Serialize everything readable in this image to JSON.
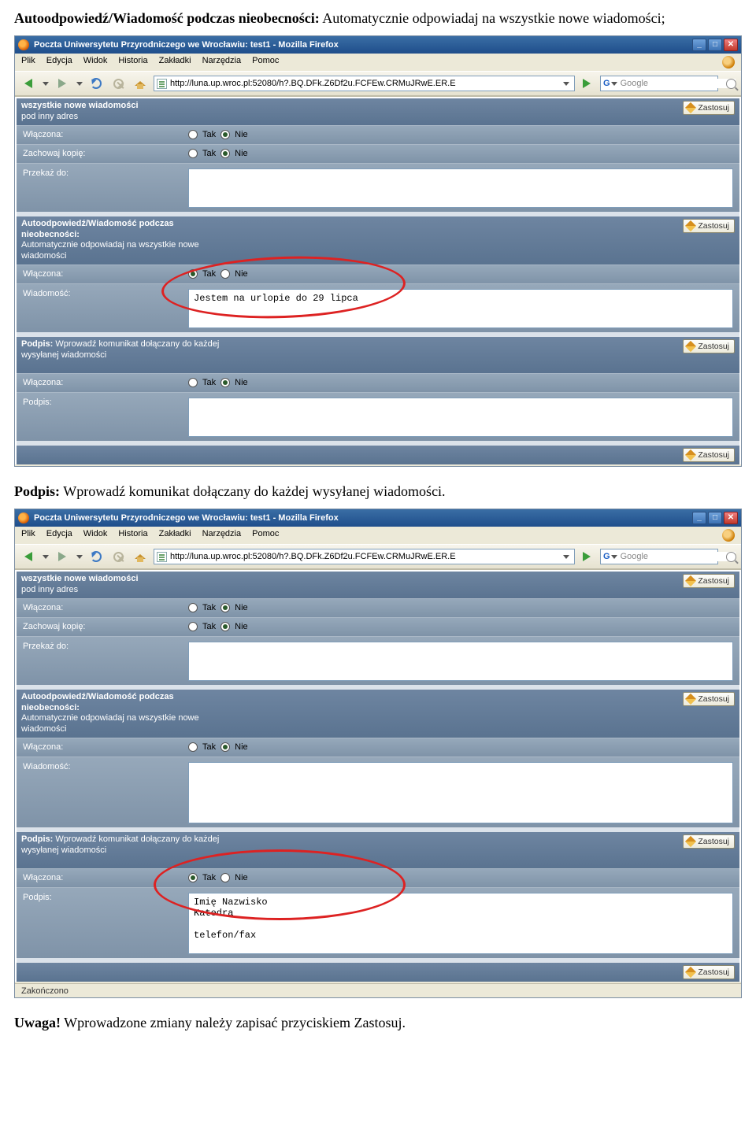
{
  "heading1_bold": "Autoodpowiedź/Wiadomość podczas nieobecności:",
  "heading1_rest": " Automatycznie odpowiadaj na wszystkie nowe wiadomości;",
  "heading2_bold": "Podpis:",
  "heading2_rest": " Wprowadź komunikat dołączany do każdej wysyłanej wiadomości.",
  "note_bold": "Uwaga!",
  "note_rest": " Wprowadzone zmiany należy zapisać przyciskiem Zastosuj.",
  "browser": {
    "title": "Poczta Uniwersytetu Przyrodniczego we Wrocławiu: test1 - Mozilla Firefox",
    "menu": {
      "plik": "Plik",
      "edycja": "Edycja",
      "widok": "Widok",
      "historia": "Historia",
      "zakladki": "Zakładki",
      "narzedzia": "Narzędzia",
      "pomoc": "Pomoc"
    },
    "url": "http://luna.up.wroc.pl:52080/h?.BQ.DFk.Z6Df2u.FCFEw.CRMuJRwE.ER.E",
    "search_placeholder": "Google",
    "min": "_",
    "max": "□",
    "close": "✕",
    "status_done": "Zakończono"
  },
  "ui": {
    "zastosuj": "Zastosuj",
    "tak": "Tak",
    "nie": "Nie",
    "forward_all": "wszystkie nowe wiadomości",
    "forward_sub": "pod inny adres",
    "wlaczona": "Włączona:",
    "zachowaj_kopie": "Zachowaj kopię:",
    "przekaz_do": "Przekaż do:",
    "auto_heading": "Autoodpowiedź/Wiadomość podczas nieobecności:",
    "auto_sub": "Automatycznie odpowiadaj na wszystkie nowe wiadomości",
    "wiadomosc": "Wiadomość:",
    "podpis_heading": "Podpis:",
    "podpis_sub": "Wprowadź komunikat dołączany do każdej wysyłanej wiadomości",
    "podpis_label": "Podpis:"
  },
  "shot1": {
    "message_text": "Jestem na urlopie do 29 lipca",
    "auto_on": "tak",
    "podpis_on": "nie",
    "podpis_text": ""
  },
  "shot2": {
    "message_text": "",
    "auto_on": "nie",
    "podpis_on": "tak",
    "podpis_line1": "Imię Nazwisko",
    "podpis_line2": "Katedra",
    "podpis_line3": "telefon/fax"
  }
}
